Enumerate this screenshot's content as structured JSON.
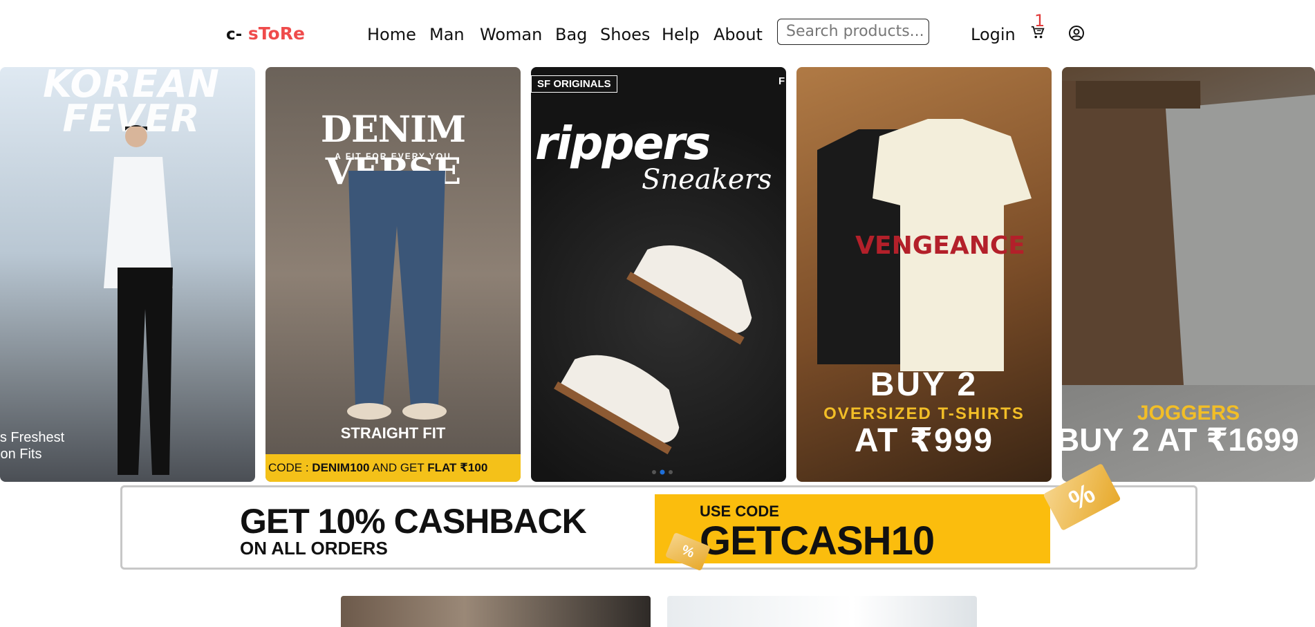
{
  "header": {
    "logo_prefix": "c-",
    "logo_brand": "sToRe",
    "nav": [
      "Home",
      "Man",
      "Woman",
      "Bag",
      "Shoes",
      "Help",
      "About"
    ],
    "search_placeholder": "Search products...",
    "login_label": "Login",
    "cart_count": "1"
  },
  "carousel": {
    "slides": [
      {
        "title": "KOREAN FEVER",
        "caption": "'s Freshest\nion Fits"
      },
      {
        "title": "DENIM VERSE",
        "subtitle": "A FIT FOR EVERY YOU",
        "tagline": "STRAIGHT FIT",
        "code_prefix": "CODE : ",
        "code": "DENIM100",
        "code_mid": " AND GET ",
        "code_flat": "FLAT ₹100"
      },
      {
        "tag": "SF ORIGINALS",
        "letter": "F",
        "title": "rippers",
        "script": "Sneakers"
      },
      {
        "line1": "BUY 2",
        "line2": "OVERSIZED T-SHIRTS",
        "line3": "AT ₹999"
      },
      {
        "line1": "JOGGERS",
        "line2": "BUY 2 AT ₹1699"
      }
    ],
    "active_index": 1
  },
  "cashback": {
    "headline": "GET 10% CASHBACK",
    "subline": "ON ALL ORDERS",
    "use_code_label": "USE CODE",
    "code": "GETCASH10"
  },
  "colors": {
    "brand": "#ef4b4b",
    "accent": "#fbbd0d"
  }
}
